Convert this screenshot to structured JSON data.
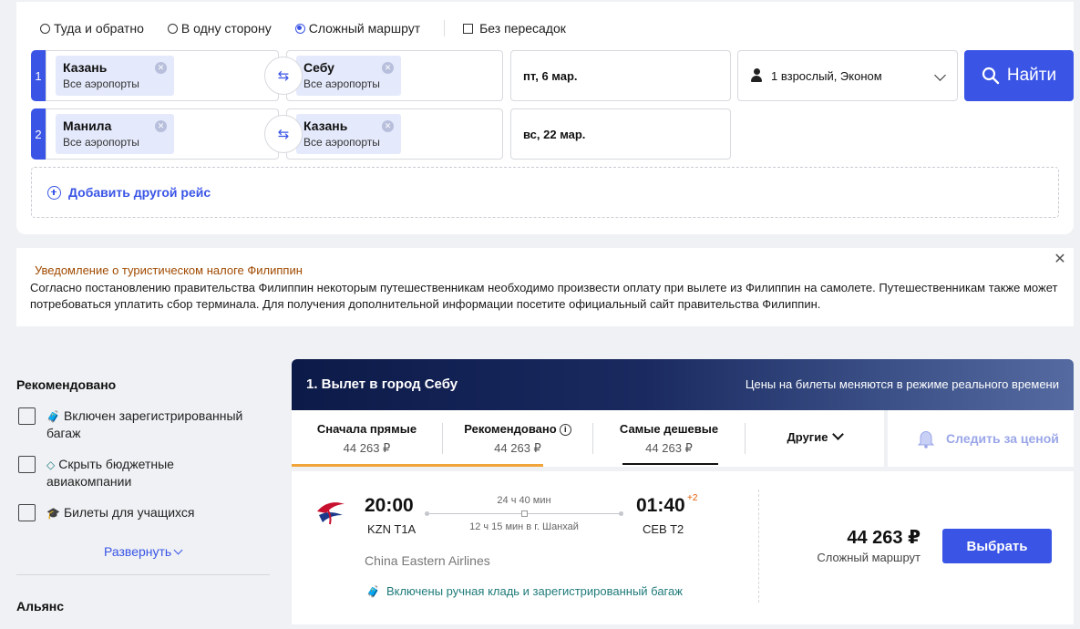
{
  "search": {
    "trip_types": [
      {
        "label": "Туда и обратно",
        "selected": false
      },
      {
        "label": "В одну сторону",
        "selected": false
      },
      {
        "label": "Сложный маршрут",
        "selected": true
      }
    ],
    "nonstop_label": "Без пересадок",
    "legs": [
      {
        "num": "1",
        "from_city": "Казань",
        "from_sub": "Все аэропорты",
        "to_city": "Себу",
        "to_sub": "Все аэропорты",
        "date": "пт, 6 мар."
      },
      {
        "num": "2",
        "from_city": "Манила",
        "from_sub": "Все аэропорты",
        "to_city": "Казань",
        "to_sub": "Все аэропорты",
        "date": "вс, 22 мар."
      }
    ],
    "passengers": "1 взрослый, Эконом",
    "find_label": "Найти",
    "add_flight_label": "Добавить другой рейс"
  },
  "notice": {
    "title": "Уведомление о туристическом налоге Филиппин",
    "body": "Согласно постановлению правительства Филиппин некоторым путешественникам необходимо произвести оплату при вылете из Филиппин на самолете. Путешественникам также может потребоваться уплатить сбор терминала. Для получения дополнительной информации посетите официальный сайт правительства Филиппин."
  },
  "filters": {
    "section_title": "Рекомендовано",
    "options": [
      {
        "label": "Включен зарегистрированный багаж",
        "icon": "luggage-icon"
      },
      {
        "label": "Скрыть бюджетные авиакомпании",
        "icon": "tag-icon"
      },
      {
        "label": "Билеты для учащихся",
        "icon": "graduation-cap-icon"
      }
    ],
    "expand_label": "Развернуть",
    "section2_title": "Альянс"
  },
  "results": {
    "banner_title": "1. Вылет в город Себу",
    "banner_note": "Цены на билеты меняются в режиме реального времени",
    "sort_tabs": [
      {
        "label": "Сначала прямые",
        "price": "44 263 ₽"
      },
      {
        "label": "Рекомендовано",
        "price": "44 263 ₽"
      },
      {
        "label": "Самые дешевые",
        "price": "44 263 ₽"
      }
    ],
    "other_label": "Другие",
    "track_label": "Следить за ценой",
    "flight": {
      "dep_time": "20:00",
      "dep_code": "KZN T1A",
      "duration": "24 ч 40 мин",
      "layover": "12 ч 15 мин в г. Шанхай",
      "arr_time": "01:40",
      "arr_plus": "+2",
      "arr_code": "CEB T2",
      "airline": "China Eastern Airlines",
      "baggage": "Включены ручная кладь и зарегистрированный багаж",
      "price": "44 263 ₽",
      "price_sub": "Сложный маршрут",
      "select_label": "Выбрать"
    }
  },
  "colors": {
    "accent": "#3a55e6",
    "sort_highlight": "#f0a43a",
    "notice_title": "#a04a00",
    "baggage": "#1e7a7a"
  }
}
